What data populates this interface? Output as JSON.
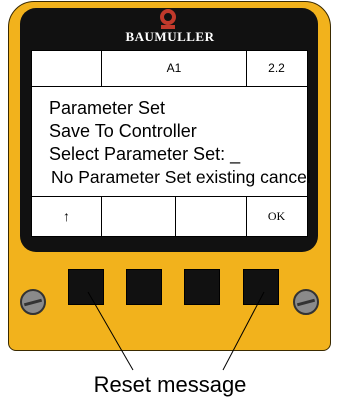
{
  "device": {
    "brand": "BAUMULLER"
  },
  "header": {
    "cell_1": "",
    "cell_2": "A1",
    "cell_3": "2.2"
  },
  "display_lines": [
    "Parameter Set",
    "Save To Controller",
    "Select Parameter Set: _",
    "No Parameter Set existing cancel"
  ],
  "softkeys": {
    "key_1": "↑",
    "key_2": "",
    "key_3": "",
    "key_4": "OK"
  },
  "caption": "Reset message",
  "colors": {
    "housing": "#f2b21c",
    "logo": "#c0392b",
    "bezel": "#111111",
    "screen": "#ffffff"
  }
}
